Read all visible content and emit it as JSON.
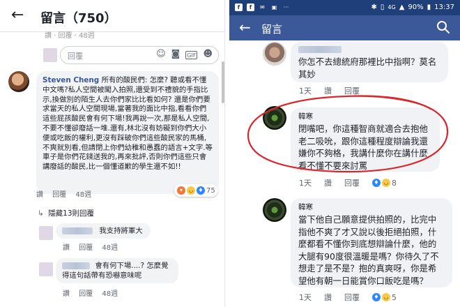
{
  "left": {
    "back_icon": "arrow-left-icon",
    "title": "留言（750）",
    "partial_line": "讚 · 回覆 · 48週",
    "reply_placeholder": "回覆",
    "reply_icons": [
      "emoji-icon",
      "camera-icon",
      "gif-icon",
      "sticker-icon"
    ],
    "gif_label": "GIF",
    "main_comment": {
      "author": "Steven Cheng",
      "text": "所有的酸民們: 怎麼? 聽或看不懂中文嗎?私人空間被闖入拍照,還受到不禮貌的手指比示,換做別的陌生人去你們家比比看如何? 還是你們要求當天的私人空間現場,當著我的面比中指,看看你們這些屁孩酸民會有何下場!我再說一次,那是私人空間,不要不懂卻廢話一堆.還有,林北沒有妨礙到你們大小便或吃飯的權利,更沒有踩破你們這些酸民家的馬桶,不爽就別看,但請閉上你們幼稚和愚蠢的語言+文字.等車子是你們花錢送我的,再來批評,否則你們這些只會講廢話的酸民,比一個懂道歉的學生還不如!!",
      "reaction_count": "75",
      "actions": [
        "讚",
        "回覆",
        "48週"
      ]
    },
    "hidden_replies": "隱藏13則回覆",
    "replies": [
      {
        "text": "我支持將軍大",
        "actions": [
          "讚",
          "回覆",
          "48週"
        ]
      },
      {
        "text": "會有何下場....? 怎麼覺得這句話帶有恐嚇意味呢",
        "actions": [
          "讚",
          "回覆",
          "48週"
        ]
      }
    ]
  },
  "right": {
    "status": {
      "time": "13:37",
      "battery": "90%",
      "network": "4G",
      "signal_icon": "signal-icon",
      "left_icons": [
        "facebook-icon",
        "facebook-icon",
        "messenger-icon",
        "image-icon",
        "more-dots-icon"
      ]
    },
    "title": "留言",
    "back_icon": "arrow-left-icon",
    "search_icon": "search-icon",
    "comments": [
      {
        "name": "",
        "text": "你怎不去總統府那裡比中指啊？莫名其妙",
        "time": "1天",
        "like": "讚",
        "reply": "回覆"
      },
      {
        "name": "韓寒",
        "text": "閉嘴吧，你這種智商就適合去抱他老二吸吮，跟你這種程度辯論我還嫌你不夠格，我講什麼你在講什麼看不懂不要來討罵",
        "time": "1天",
        "like": "讚",
        "reply": "回覆",
        "reaction_count": "8",
        "circled": true
      },
      {
        "name": "韓寒",
        "text": "當下他自己願意提供拍照的，比完中指他不爽了才又說以後拒絕拍照，什麼都看不懂你到底想辯論什麼，他的大腿有90度很溫暖是嗎？你待久了不想走了是不是？抱的真爽呀，你是希望他有朝一日能賞你口飯吃是嗎？",
        "time": "1天",
        "like": "讚",
        "reply": "回覆",
        "reaction_count": "5"
      }
    ]
  },
  "colors": {
    "fb_blue": "#3b5998",
    "status_blue": "#1f3f7a",
    "bubble_gray": "#f0f2f5",
    "link_blue": "#385898",
    "annotation_red": "#d9262b"
  }
}
